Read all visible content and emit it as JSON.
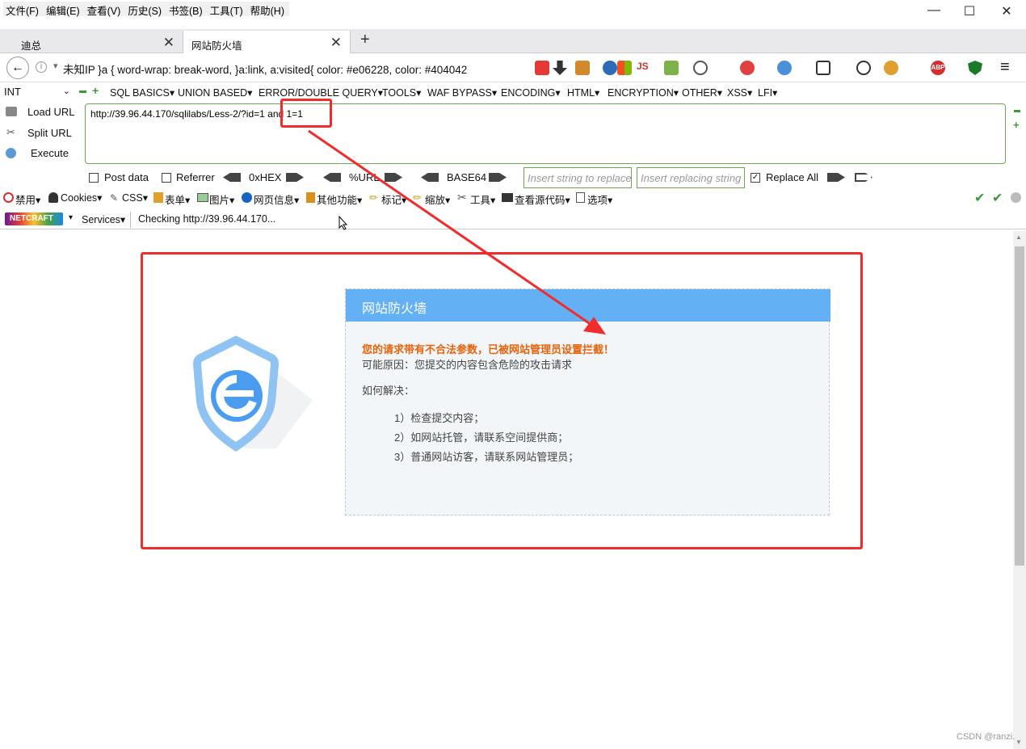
{
  "menubar": {
    "items": [
      "文件(F)",
      "编辑(E)",
      "查看(V)",
      "历史(S)",
      "书签(B)",
      "工具(T)",
      "帮助(H)"
    ]
  },
  "window": {
    "minimize": "—",
    "maximize": "☐",
    "close": "✕"
  },
  "tabs": [
    {
      "label": "迪总",
      "close": "✕"
    },
    {
      "label": "网站防火墙",
      "close": "✕",
      "active": true
    }
  ],
  "newtab": "+",
  "nav": {
    "back": "←",
    "info": "i",
    "url_prefix": "▾",
    "url_text": "未知IP   }a { word-wrap: break-word, }a:link, a:visited{ color: #e06228, color: #404042"
  },
  "hackbar": {
    "int_select": "INT",
    "menus": [
      "SQL BASICS▾",
      "UNION BASED▾",
      "ERROR/DOUBLE QUERY▾",
      "TOOLS▾",
      "WAF BYPASS▾",
      "ENCODING▾",
      "HTML▾",
      "ENCRYPTION▾",
      "OTHER▾",
      "XSS▾",
      "LFI▾"
    ],
    "side": [
      "Load URL",
      "Split URL",
      "Execute"
    ],
    "url_value": "http://39.96.44.170/sqlilabs/Less-2/?id=1 and 1=1",
    "post_data": "Post data",
    "referrer": "Referrer",
    "hex": "0xHEX",
    "url_enc": "%URL",
    "base64": "BASE64",
    "insert_placeholder": "Insert string to replace",
    "replacing_placeholder": "Insert replacing string",
    "replace_all": "Replace All"
  },
  "webdev": {
    "items": [
      "禁用▾",
      "Cookies▾",
      "CSS▾",
      "表单▾",
      "图片▾",
      "网页信息▾",
      "其他功能▾",
      "标记▾",
      "缩放▾",
      "工具▾",
      "查看源代码▾",
      "选项▾"
    ]
  },
  "netcraft": {
    "logo": "NETCRAFT",
    "dropdown": "▾",
    "services": "Services▾",
    "status": "Checking http://39.96.44.170..."
  },
  "firewall": {
    "title": "网站防火墙",
    "warning": "您的请求带有不合法参数，已被网站管理员设置拦截！",
    "reason": "可能原因：您提交的内容包含危险的攻击请求",
    "howto": "如何解决：",
    "steps": [
      "1）检查提交内容；",
      "2）如网站托管，请联系空间提供商；",
      "3）普通网站访客，请联系网站管理员；"
    ]
  },
  "watermark": "CSDN @ranzi.",
  "colors": {
    "accent_red": "#f02c2c",
    "firewall_blue": "#63b0f5",
    "warning_orange": "#e8620a",
    "hackbar_green": "#6aa84f"
  }
}
